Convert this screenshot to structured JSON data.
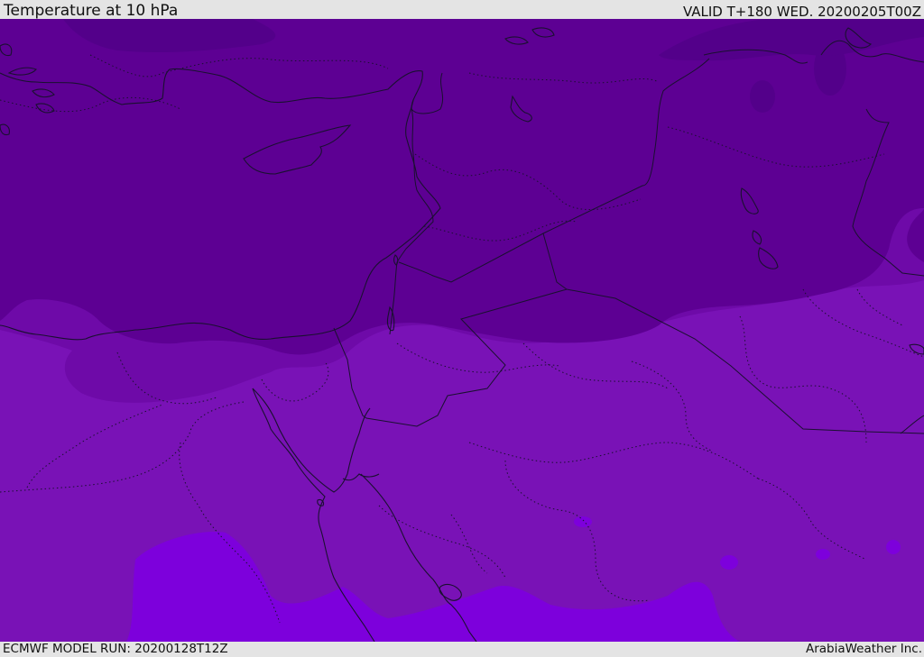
{
  "header": {
    "title": "Temperature at 10 hPa",
    "valid": "VALID T+180 WED. 20200205T00Z"
  },
  "footer": {
    "model_run": "ECMWF MODEL RUN: 20200128T12Z",
    "credit": "ArabiaWeather Inc."
  },
  "map": {
    "colors": {
      "band_dark": "#5d0093",
      "band_mid": "#6e0aa8",
      "band_light": "#7912b6",
      "band_bright": "#7d00dc",
      "lines": "#1a1030"
    }
  }
}
